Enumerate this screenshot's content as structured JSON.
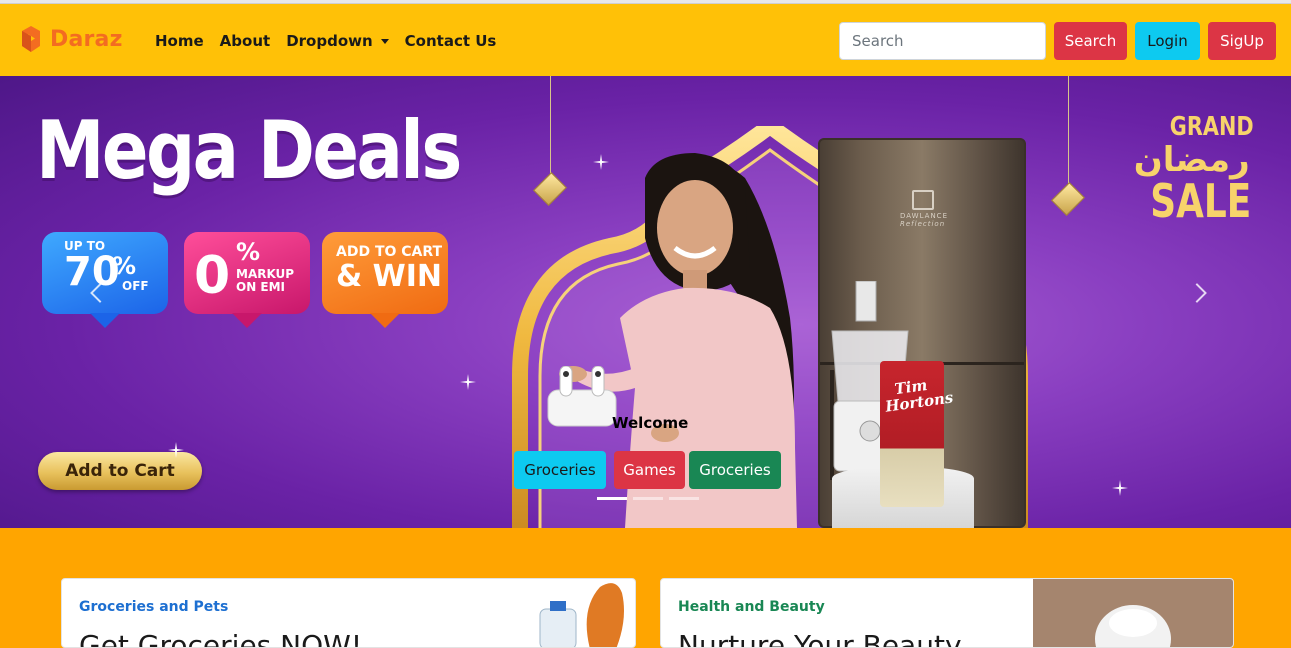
{
  "brand": {
    "name": "Daraz",
    "color": "#f36c21"
  },
  "nav": {
    "items": [
      {
        "label": "Home"
      },
      {
        "label": "About"
      },
      {
        "label": "Dropdown"
      },
      {
        "label": "Contact Us"
      }
    ]
  },
  "search": {
    "placeholder": "Search",
    "value": "",
    "button": "Search"
  },
  "auth": {
    "login": "Login",
    "signup": "SigUp"
  },
  "colors": {
    "navbar": "#ffc107",
    "page": "#ffa500",
    "danger": "#dc3545",
    "info": "#0dcaf0",
    "success": "#198754"
  },
  "hero": {
    "banner": {
      "headline": "Mega Deals",
      "badges": [
        {
          "top": "UP TO",
          "big": "70",
          "suffix": "%",
          "bottom": "OFF"
        },
        {
          "big": "0",
          "suffix": "%",
          "line1": "MARKUP",
          "line2": "ON EMI"
        },
        {
          "line1": "ADD TO CART",
          "line2": "& WIN"
        }
      ],
      "cta": "Add to Cart",
      "side": {
        "line1": "GRAND",
        "arabic": "رمضان",
        "line3": "SALE"
      },
      "fridge_brand": "DAWLANCE",
      "fridge_sub": "Reflection",
      "coffee_brand": "Tim Hortons"
    },
    "caption": "Welcome",
    "buttons": [
      {
        "label": "Groceries"
      },
      {
        "label": "Games"
      },
      {
        "label": "Groceries"
      }
    ],
    "indicators": 3,
    "active_slide": 1
  },
  "cards": [
    {
      "title": "Groceries and Pets",
      "heading": "Get Groceries NOW!"
    },
    {
      "title": "Health and Beauty",
      "heading": "Nurture Your Beauty"
    }
  ]
}
